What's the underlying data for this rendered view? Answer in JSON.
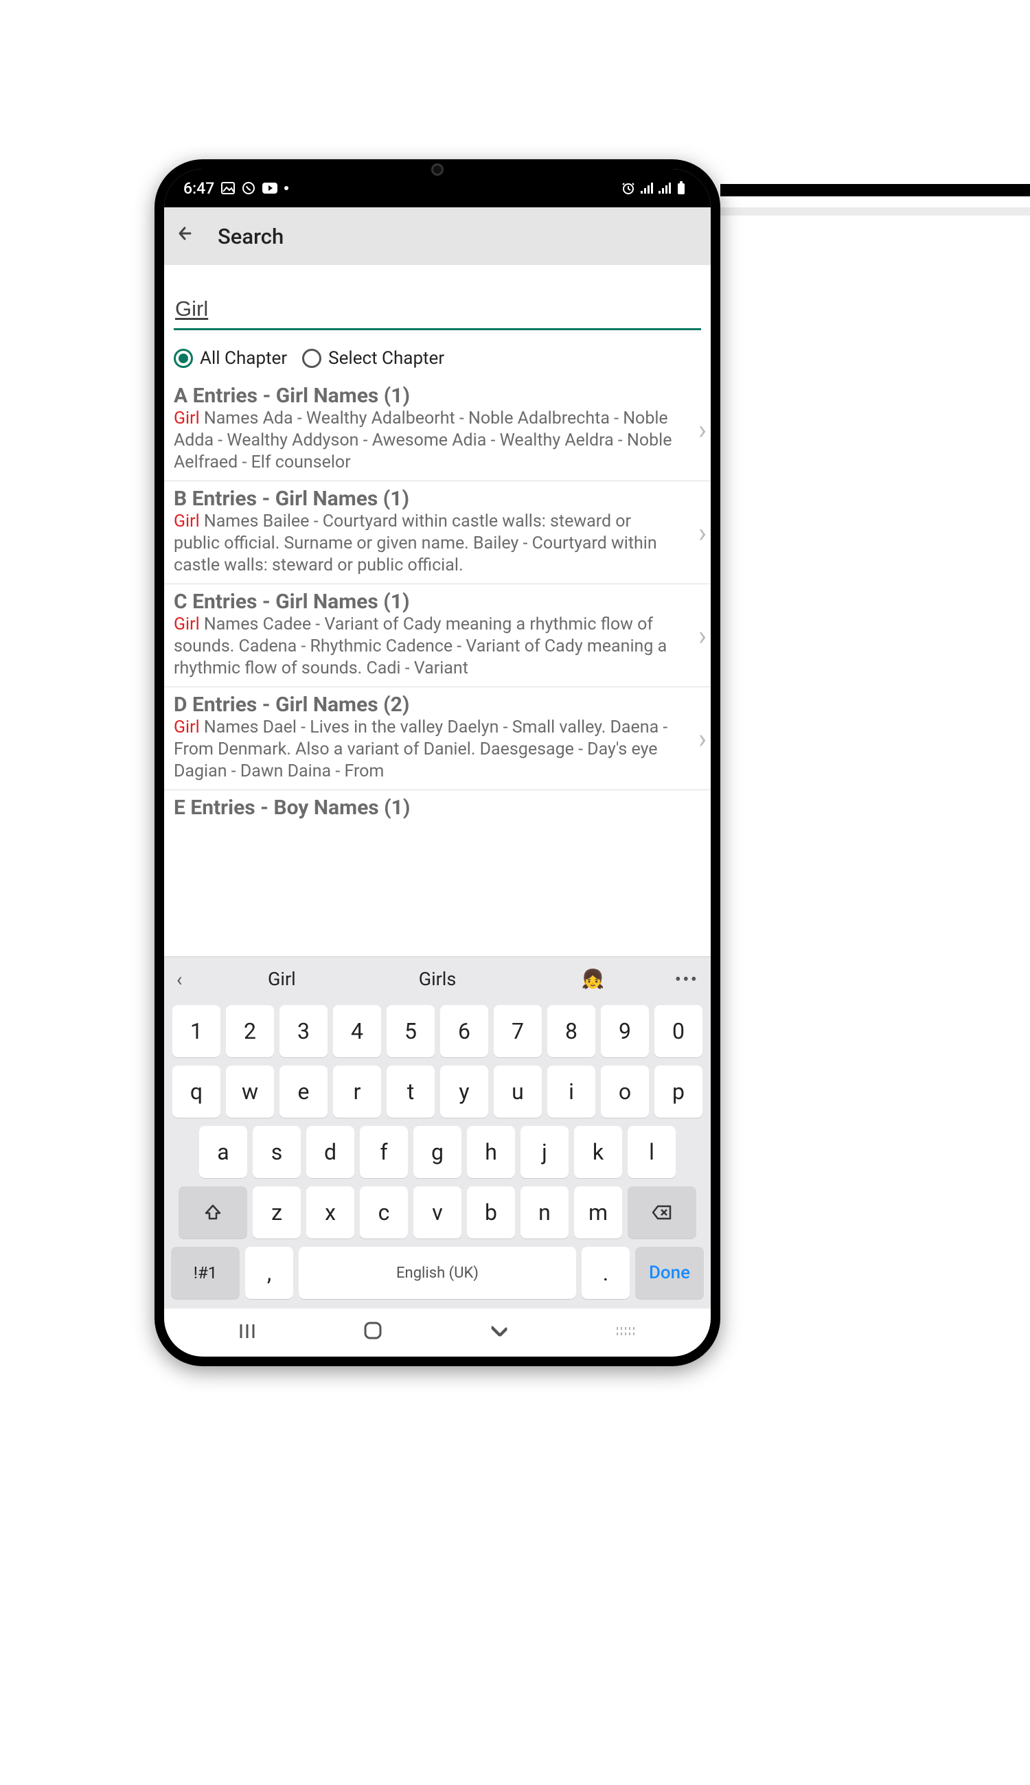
{
  "status": {
    "time": "6:47",
    "right_icons": [
      "alarm",
      "signal",
      "signal",
      "battery"
    ],
    "left_icons": [
      "image",
      "whatsapp",
      "youtube",
      "dot"
    ]
  },
  "header": {
    "title": "Search"
  },
  "search": {
    "value": "Girl"
  },
  "radios": {
    "all": "All Chapter",
    "select": "Select Chapter"
  },
  "results": [
    {
      "title": "A Entries - Girl Names (1)",
      "hl": "Girl",
      "rest": " Names Ada - Wealthy Adalbeorht - Noble Adalbrechta - Noble Adda - Wealthy Addyson - Awesome Adia - Wealthy Aeldra - Noble Aelfraed - Elf counselor"
    },
    {
      "title": "B Entries - Girl Names (1)",
      "hl": "Girl",
      "rest": " Names Bailee - Courtyard within castle walls: steward or public official. Surname or given name. Bailey - Courtyard within castle walls: steward or public official."
    },
    {
      "title": "C Entries - Girl Names (1)",
      "hl": "Girl",
      "rest": " Names Cadee - Variant of Cady meaning a rhythmic flow of sounds. Cadena - Rhythmic Cadence - Variant of Cady meaning a rhythmic flow of sounds. Cadi - Variant"
    },
    {
      "title": "D Entries - Girl Names (2)",
      "hl": "Girl",
      "rest": " Names Dael - Lives in the valley Daelyn - Small valley. Daena - From Denmark. Also a variant of Daniel. Daesgesage - Day's eye Dagian - Dawn Daina - From"
    }
  ],
  "cutoff": "E Entries - Boy Names (1)",
  "suggestions": {
    "s1": "Girl",
    "s2": "Girls",
    "s3": "👧"
  },
  "keyboard": {
    "row1": [
      "1",
      "2",
      "3",
      "4",
      "5",
      "6",
      "7",
      "8",
      "9",
      "0"
    ],
    "row2": [
      "q",
      "w",
      "e",
      "r",
      "t",
      "y",
      "u",
      "i",
      "o",
      "p"
    ],
    "row3": [
      "a",
      "s",
      "d",
      "f",
      "g",
      "h",
      "j",
      "k",
      "l"
    ],
    "row4": [
      "z",
      "x",
      "c",
      "v",
      "b",
      "n",
      "m"
    ],
    "sym": "!#1",
    "comma": ",",
    "space": "English (UK)",
    "period": ".",
    "done": "Done"
  }
}
